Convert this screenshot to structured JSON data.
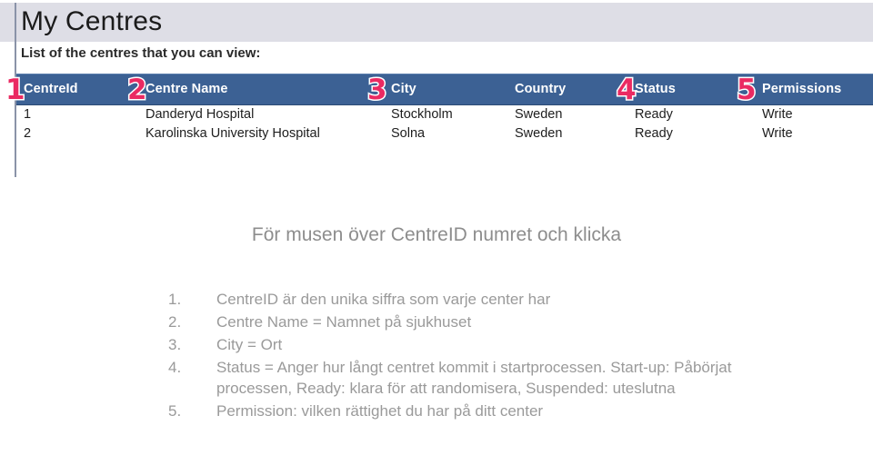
{
  "screenshot": {
    "title": "My Centres",
    "subtitle": "List of the centres that you can view:",
    "accent_header_color": "#3c6194",
    "title_band_color": "#dedee6",
    "badge_color": "#ea2a62",
    "table": {
      "columns": [
        {
          "label": "CentreId",
          "badge": "1"
        },
        {
          "label": "Centre Name",
          "badge": "2"
        },
        {
          "label": "City",
          "badge": "3"
        },
        {
          "label": "Country",
          "badge": ""
        },
        {
          "label": "Status",
          "badge": "4"
        },
        {
          "label": "Permissions",
          "badge": "5"
        }
      ],
      "rows": [
        {
          "centre_id": "1",
          "centre_name": "Danderyd Hospital",
          "city": "Stockholm",
          "country": "Sweden",
          "status": "Ready",
          "permissions": "Write"
        },
        {
          "centre_id": "2",
          "centre_name": "Karolinska University Hospital",
          "city": "Solna",
          "country": "Sweden",
          "status": "Ready",
          "permissions": "Write"
        }
      ]
    }
  },
  "notes": {
    "heading": "För musen över CentreID numret och klicka",
    "items": [
      {
        "number": "1.",
        "text": "CentreID är den unika siffra som varje center har"
      },
      {
        "number": "2.",
        "text": "Centre Name = Namnet på sjukhuset"
      },
      {
        "number": "3.",
        "text": "City = Ort"
      },
      {
        "number": "4.",
        "text": "Status = Anger hur långt centret kommit i startprocessen. Start-up: Påbörjat processen, Ready: klara för att randomisera, Suspended: uteslutna"
      },
      {
        "number": "5.",
        "text": "Permission: vilken rättighet du har på ditt center"
      }
    ]
  }
}
